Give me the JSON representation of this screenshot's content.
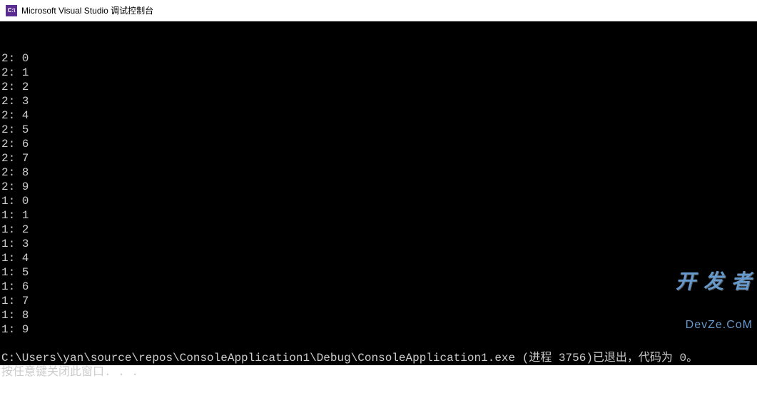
{
  "window": {
    "title": "Microsoft Visual Studio 调试控制台",
    "icon_label": "C:\\"
  },
  "console": {
    "lines": [
      "2: 0",
      "2: 1",
      "2: 2",
      "2: 3",
      "2: 4",
      "2: 5",
      "2: 6",
      "2: 7",
      "2: 8",
      "2: 9",
      "1: 0",
      "1: 1",
      "1: 2",
      "1: 3",
      "1: 4",
      "1: 5",
      "1: 6",
      "1: 7",
      "1: 8",
      "1: 9",
      "",
      "C:\\Users\\yan\\source\\repos\\ConsoleApplication1\\Debug\\ConsoleApplication1.exe (进程 3756)已退出，代码为 0。",
      "按任意键关闭此窗口. . ."
    ]
  },
  "watermark": {
    "line1": "开 发 者",
    "line2": "DevZe.CoM"
  }
}
